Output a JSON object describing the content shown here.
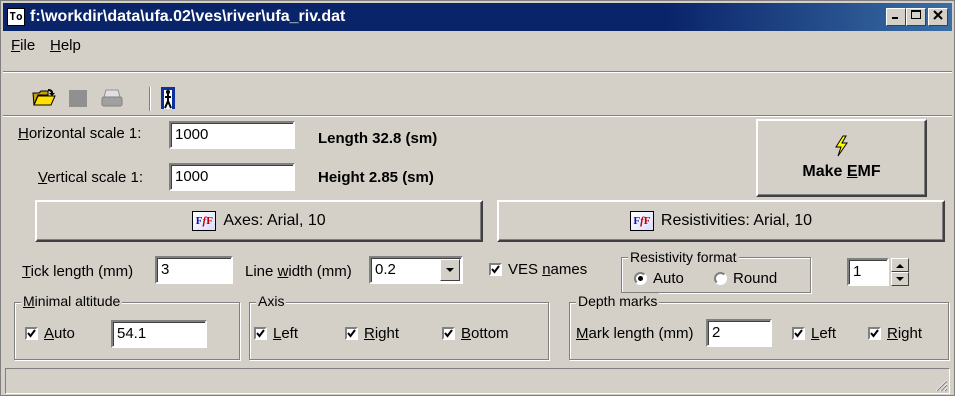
{
  "window": {
    "title": "f:\\workdir\\data\\ufa.02\\ves\\river\\ufa_riv.dat",
    "app_icon_text": "To",
    "controls": [
      "minimize-icon",
      "maximize-icon",
      "close-icon"
    ]
  },
  "menu": [
    {
      "label_u": "F",
      "label_rest": "ile"
    },
    {
      "label_u": "H",
      "label_rest": "elp"
    }
  ],
  "toolbar": [
    "open-folder-icon",
    "save-icon",
    "print-icon",
    "exit-door-icon"
  ],
  "scale": {
    "horizontal_label_u": "H",
    "horizontal_label_rest": "orizontal scale 1:",
    "horizontal_value": "1000",
    "vertical_label_pre": " ",
    "vertical_label_u": "V",
    "vertical_label_rest": "ertical scale 1:",
    "vertical_value": "1000",
    "length_text": "Length 32.8 (sm)",
    "height_text": "Height 2.85 (sm)"
  },
  "make_emf": {
    "label_pre": "Make ",
    "label_u": "E",
    "label_rest": "MF",
    "icon": "lightning-icon"
  },
  "fonts": {
    "axes_label": "Axes: Arial, 10",
    "resistivities_label": "Resistivities: Arial, 10",
    "icon_text_a": "F",
    "icon_text_b": "f",
    "icon_text_c": "F"
  },
  "params": {
    "tick_label_u": "T",
    "tick_label_rest": "ick length (mm)",
    "tick_value": "3",
    "line_label_pre": "Line ",
    "line_label_u": "w",
    "line_label_rest": "idth (mm)",
    "line_value": "0.2",
    "ves_names_pre": "VES ",
    "ves_names_u": "n",
    "ves_names_rest": "ames",
    "ves_names_checked": true,
    "spin_value": "1"
  },
  "resistivity_format": {
    "title": "Resistivity format",
    "options": [
      "Auto",
      "Round"
    ],
    "selected": "Auto"
  },
  "minimal_altitude": {
    "title_u": "M",
    "title_rest": "inimal altitude",
    "auto_u": "A",
    "auto_rest": "uto",
    "auto_checked": true,
    "value": "54.1"
  },
  "axis": {
    "title": "Axis",
    "items": [
      {
        "u": "L",
        "rest": "eft",
        "checked": true
      },
      {
        "u": "R",
        "rest": "ight",
        "checked": true
      },
      {
        "u": "B",
        "rest": "ottom",
        "checked": true
      }
    ]
  },
  "depth_marks": {
    "title": "Depth marks",
    "mark_label_u": "M",
    "mark_label_rest": "ark length (mm)",
    "mark_value": "2",
    "left_u": "L",
    "left_rest": "eft",
    "left_checked": true,
    "right_u": "R",
    "right_rest": "ight",
    "right_checked": true
  }
}
